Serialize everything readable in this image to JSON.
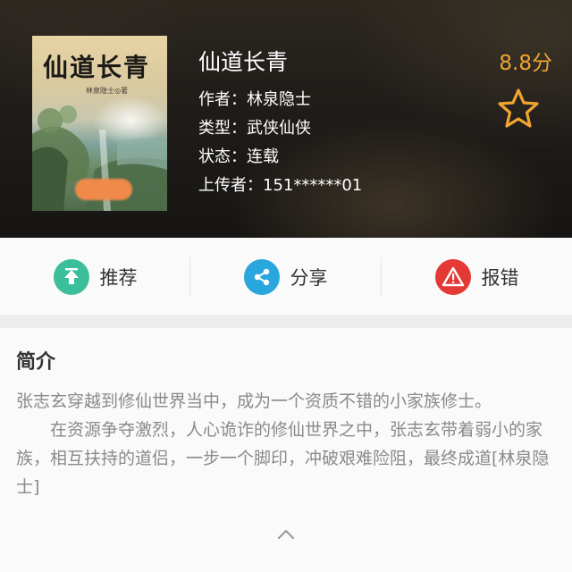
{
  "book": {
    "title": "仙道长青",
    "author": "作者：林泉隐士",
    "genre": "类型：武侠仙侠",
    "status": "状态：连载",
    "uploader": "上传者：151******01",
    "score": "8.8分",
    "cover_title": "仙道长青",
    "cover_author": "林泉隐士◎著"
  },
  "actions": [
    {
      "label": "推荐",
      "icon": "up-arrow-icon",
      "color": "#3bbf9a"
    },
    {
      "label": "分享",
      "icon": "share-icon",
      "color": "#2aa6de"
    },
    {
      "label": "报错",
      "icon": "warning-icon",
      "color": "#e53935"
    }
  ],
  "intro": {
    "heading": "简介",
    "paragraph1": "张志玄穿越到修仙世界当中，成为一个资质不错的小家族修士。",
    "paragraph2": "在资源争夺激烈，人心诡诈的修仙世界之中，张志玄带着弱小的家族，相互扶持的道侣，一步一个脚印，冲破艰难险阻，最终成道[林泉隐士]"
  },
  "colors": {
    "score": "#f0a531",
    "text_primary": "#333333",
    "text_secondary": "#8a8a8a"
  }
}
